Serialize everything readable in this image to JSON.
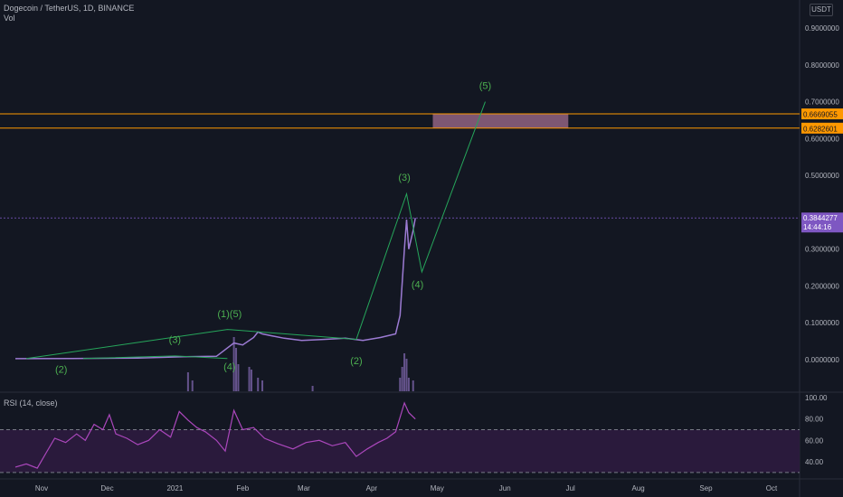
{
  "header": {
    "symbol_line": "Dogecoin / TetherUS, 1D, BINANCE",
    "volume_label": "Vol"
  },
  "currency_button": "USDT",
  "rsi_title": "RSI (14, close)",
  "colors": {
    "background": "#131722",
    "grid": "#1e222d",
    "axis_text": "#b2b5be",
    "wave_line": "#26a65b",
    "wave_label": "#4caf50",
    "level_line": "#ff9800",
    "level_badge": "#ff9800",
    "price_badge": "#7e57c2",
    "candle": "#9c7bd3",
    "rsi_line": "#ab47bc",
    "rsi_band": "#2a1a3c",
    "target_box": "#a36d8f"
  },
  "price_badge": {
    "price": "0.3844277",
    "countdown": "14:44:16"
  },
  "chart_data": {
    "type": "line",
    "title": "Dogecoin / TetherUS, 1D, BINANCE",
    "xlabel": "",
    "ylabel": "",
    "x_ticks": [
      "Nov",
      "Dec",
      "2021",
      "Feb",
      "Mar",
      "Apr",
      "May",
      "Jun",
      "Jul",
      "Aug",
      "Sep",
      "Oct"
    ],
    "y_ticks": [
      "0.9000000",
      "0.8000000",
      "0.7000000",
      "0.6000000",
      "0.5000000",
      "0.3000000",
      "0.2000000",
      "0.1000000",
      "0.0000000"
    ],
    "ylim": [
      -0.05,
      1.0
    ],
    "grid": false,
    "price_series": {
      "name": "",
      "points": [
        [
          "2020-10-20",
          0.0026
        ],
        [
          "2020-11-15",
          0.003
        ],
        [
          "2020-12-15",
          0.0045
        ],
        [
          "2021-01-05",
          0.008
        ],
        [
          "2021-01-20",
          0.009
        ],
        [
          "2021-01-28",
          0.045
        ],
        [
          "2021-02-01",
          0.04
        ],
        [
          "2021-02-06",
          0.06
        ],
        [
          "2021-02-08",
          0.075
        ],
        [
          "2021-02-10",
          0.07
        ],
        [
          "2021-02-14",
          0.065
        ],
        [
          "2021-02-20",
          0.058
        ],
        [
          "2021-02-28",
          0.052
        ],
        [
          "2021-03-10",
          0.055
        ],
        [
          "2021-03-20",
          0.058
        ],
        [
          "2021-03-28",
          0.052
        ],
        [
          "2021-04-05",
          0.06
        ],
        [
          "2021-04-12",
          0.07
        ],
        [
          "2021-04-14",
          0.12
        ],
        [
          "2021-04-16",
          0.3
        ],
        [
          "2021-04-17",
          0.38
        ],
        [
          "2021-04-18",
          0.3
        ],
        [
          "2021-04-20",
          0.35
        ],
        [
          "2021-04-21",
          0.3844
        ]
      ]
    },
    "elliott_waves": [
      {
        "name": "primary",
        "points": [
          [
            "2020-10-25",
            0.003
          ],
          [
            "2021-01-25",
            0.082
          ],
          [
            "2021-03-25",
            0.055
          ],
          [
            "2021-04-17",
            0.45
          ],
          [
            "2021-04-24",
            0.238
          ],
          [
            "2021-05-23",
            0.7
          ]
        ]
      },
      {
        "name": "sub",
        "points": [
          [
            "2020-11-20",
            0.003
          ],
          [
            "2021-01-01",
            0.01
          ],
          [
            "2021-01-25",
            0.003
          ]
        ]
      }
    ],
    "wave_labels": [
      {
        "label": "(2)",
        "x": "2020-11-10",
        "y": -0.035
      },
      {
        "label": "(3)",
        "x": "2021-01-01",
        "y": 0.045
      },
      {
        "label": "(1)(5)",
        "x": "2021-01-26",
        "y": 0.115
      },
      {
        "label": "(4)",
        "x": "2021-01-26",
        "y": -0.028
      },
      {
        "label": "(2)",
        "x": "2021-03-25",
        "y": -0.012
      },
      {
        "label": "(3)",
        "x": "2021-04-16",
        "y": 0.485
      },
      {
        "label": "(4)",
        "x": "2021-04-22",
        "y": 0.195
      },
      {
        "label": "(5)",
        "x": "2021-05-23",
        "y": 0.735
      }
    ],
    "horizontal_levels": [
      {
        "value": 0.6669055,
        "label": "0.6669055"
      },
      {
        "value": 0.6282601,
        "label": "0.6282601"
      }
    ],
    "target_zone": {
      "x_start": "2021-04-29",
      "x_end": "2021-06-30",
      "y_low": 0.6282601,
      "y_high": 0.6669055
    },
    "last_price": 0.3844277,
    "volume": {
      "name": "Vol",
      "bars": [
        [
          "2021-01-07",
          0.35
        ],
        [
          "2021-01-09",
          0.2
        ],
        [
          "2021-01-28",
          1.0
        ],
        [
          "2021-01-29",
          0.8
        ],
        [
          "2021-01-30",
          0.5
        ],
        [
          "2021-02-04",
          0.45
        ],
        [
          "2021-02-05",
          0.4
        ],
        [
          "2021-02-08",
          0.25
        ],
        [
          "2021-02-10",
          0.2
        ],
        [
          "2021-03-05",
          0.1
        ],
        [
          "2021-04-14",
          0.25
        ],
        [
          "2021-04-15",
          0.45
        ],
        [
          "2021-04-16",
          0.7
        ],
        [
          "2021-04-17",
          0.6
        ],
        [
          "2021-04-18",
          0.25
        ],
        [
          "2021-04-20",
          0.2
        ]
      ]
    },
    "rsi": {
      "name": "RSI (14, close)",
      "y_ticks": [
        "100.00",
        "80.00",
        "60.00",
        "40.00"
      ],
      "ylim": [
        25,
        103
      ],
      "band": [
        30,
        70
      ],
      "points": [
        [
          "2020-10-20",
          35
        ],
        [
          "2020-10-25",
          38
        ],
        [
          "2020-10-30",
          34
        ],
        [
          "2020-11-03",
          48
        ],
        [
          "2020-11-07",
          62
        ],
        [
          "2020-11-12",
          58
        ],
        [
          "2020-11-17",
          66
        ],
        [
          "2020-11-21",
          60
        ],
        [
          "2020-11-25",
          75
        ],
        [
          "2020-11-29",
          70
        ],
        [
          "2020-12-02",
          84
        ],
        [
          "2020-12-05",
          66
        ],
        [
          "2020-12-10",
          62
        ],
        [
          "2020-12-15",
          56
        ],
        [
          "2020-12-20",
          60
        ],
        [
          "2020-12-25",
          70
        ],
        [
          "2020-12-30",
          63
        ],
        [
          "2021-01-03",
          87
        ],
        [
          "2021-01-07",
          79
        ],
        [
          "2021-01-11",
          72
        ],
        [
          "2021-01-15",
          68
        ],
        [
          "2021-01-20",
          60
        ],
        [
          "2021-01-24",
          50
        ],
        [
          "2021-01-28",
          88
        ],
        [
          "2021-02-01",
          70
        ],
        [
          "2021-02-06",
          72
        ],
        [
          "2021-02-11",
          62
        ],
        [
          "2021-02-17",
          57
        ],
        [
          "2021-02-24",
          52
        ],
        [
          "2021-03-02",
          58
        ],
        [
          "2021-03-08",
          60
        ],
        [
          "2021-03-14",
          55
        ],
        [
          "2021-03-20",
          58
        ],
        [
          "2021-03-25",
          45
        ],
        [
          "2021-03-30",
          52
        ],
        [
          "2021-04-04",
          58
        ],
        [
          "2021-04-08",
          62
        ],
        [
          "2021-04-12",
          68
        ],
        [
          "2021-04-16",
          95
        ],
        [
          "2021-04-18",
          86
        ],
        [
          "2021-04-21",
          80
        ]
      ]
    }
  }
}
